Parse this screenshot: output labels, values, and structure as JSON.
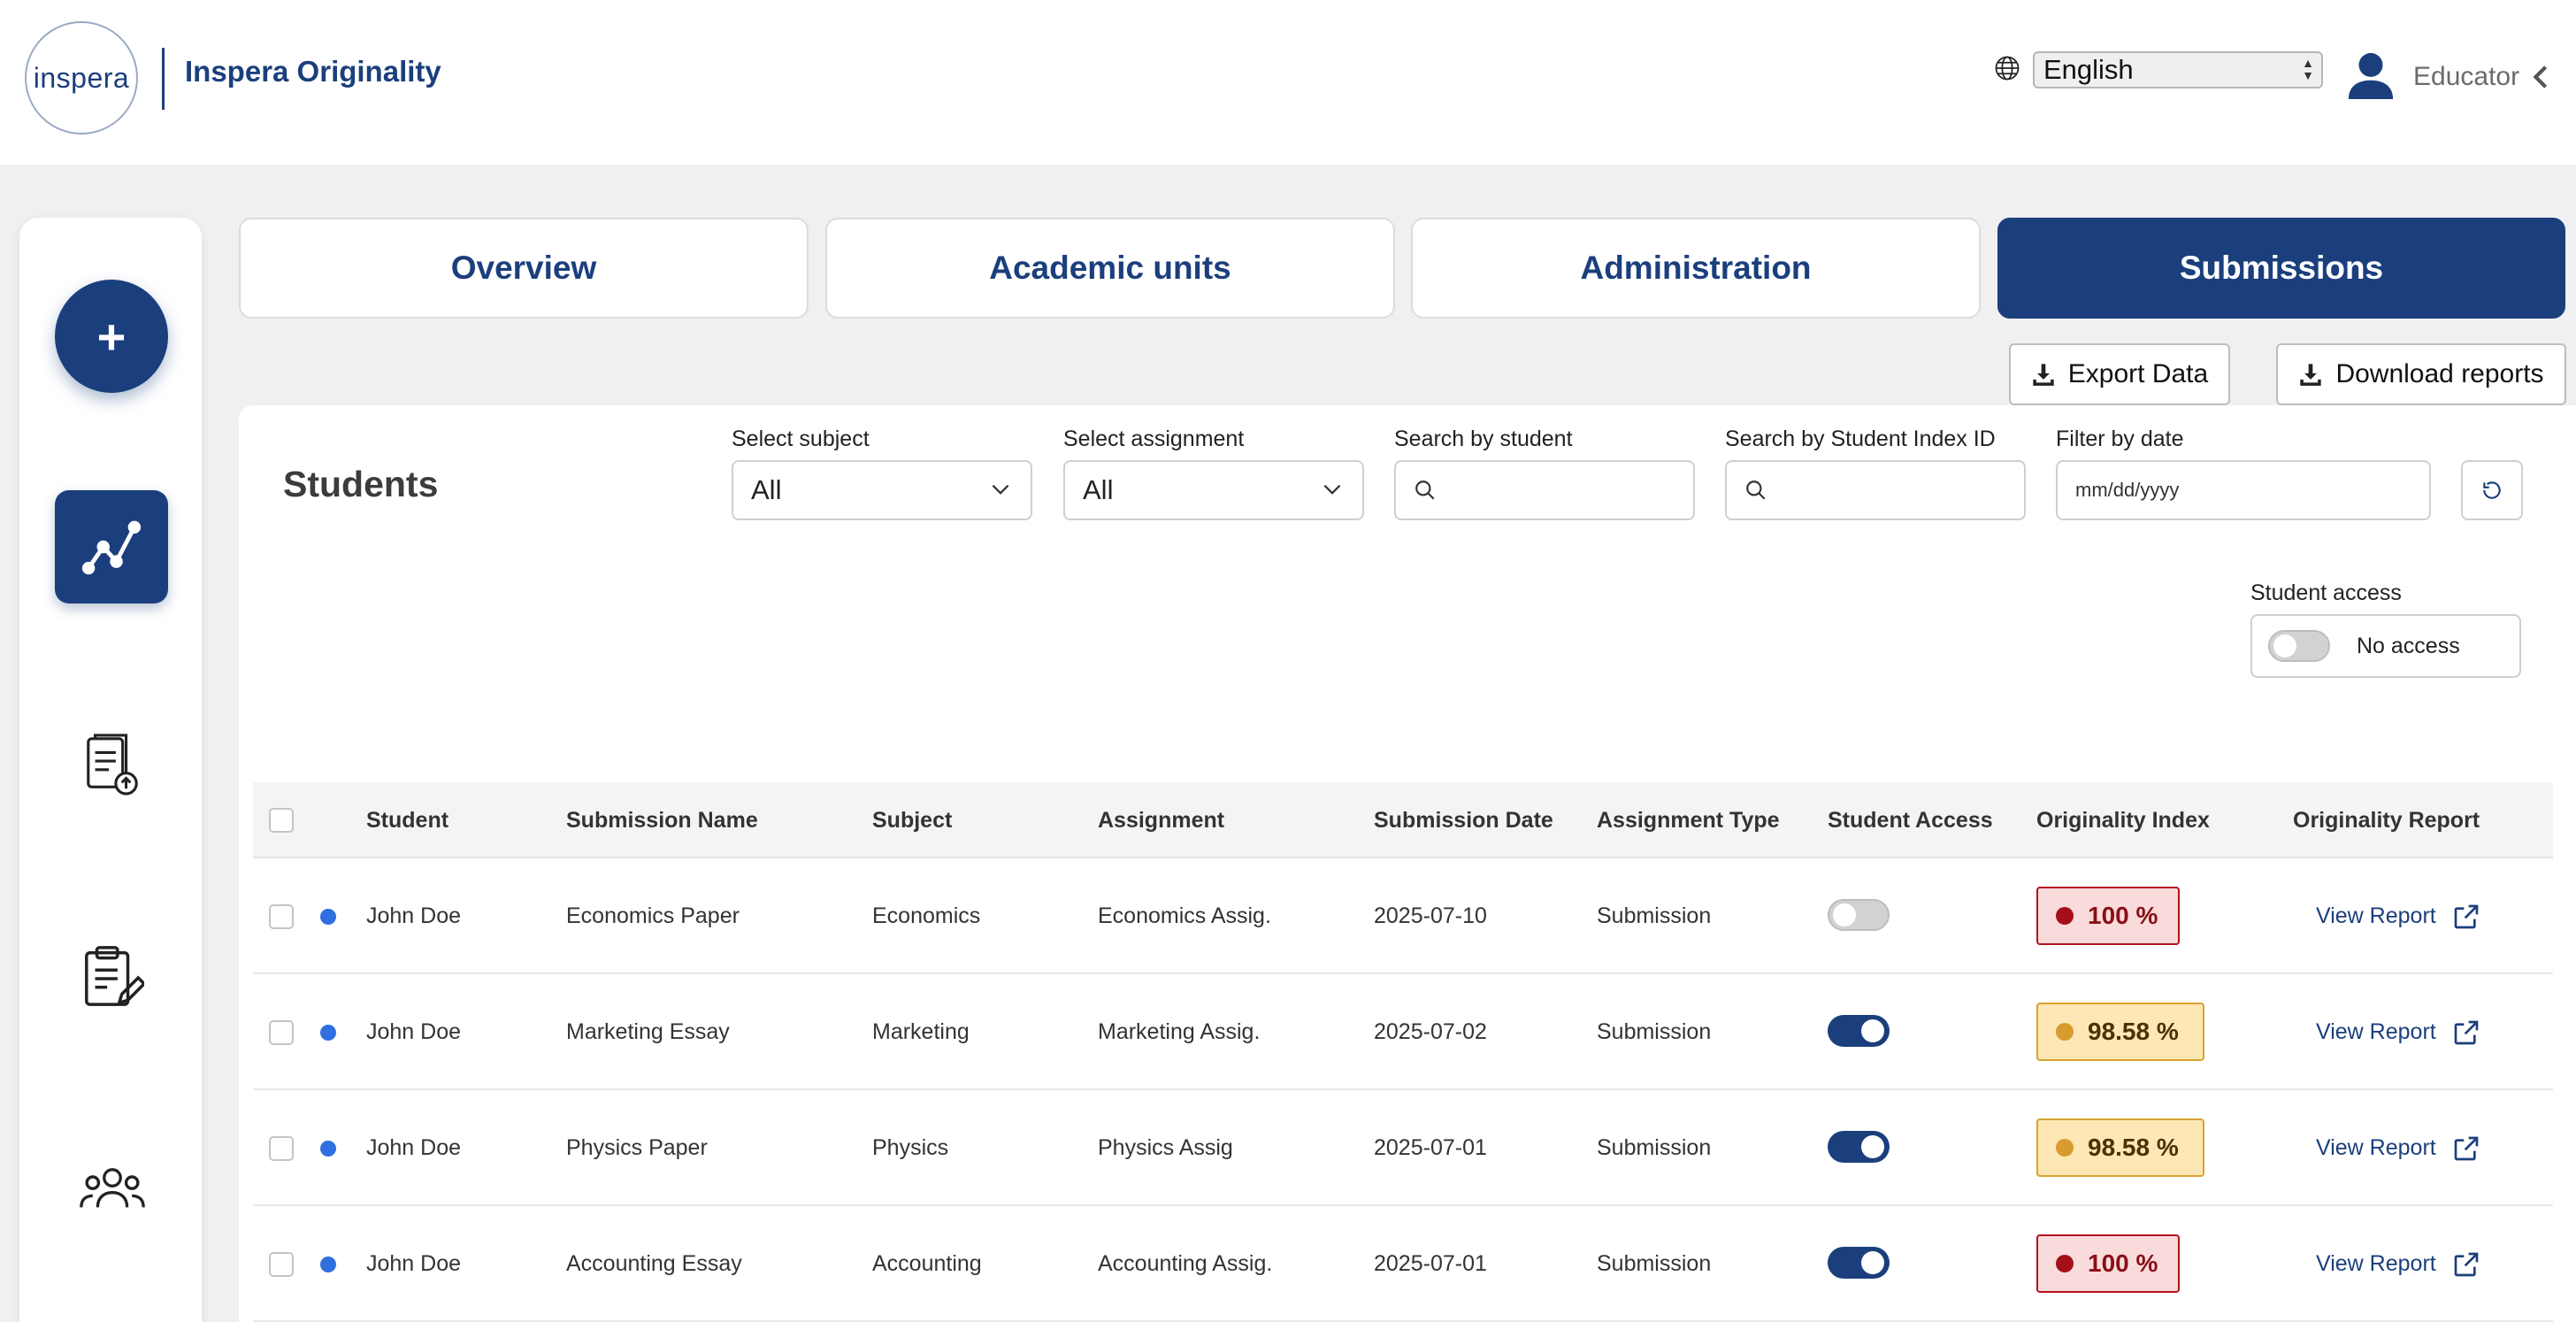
{
  "header": {
    "logo_text": "inspera",
    "app_name": "Inspera Originality",
    "language": "English",
    "role": "Educator"
  },
  "sidebar": {
    "add_label": "+",
    "items": [
      {
        "icon": "analytics-icon",
        "active": true
      },
      {
        "icon": "document-upload-icon",
        "active": false
      },
      {
        "icon": "clipboard-edit-icon",
        "active": false
      },
      {
        "icon": "users-icon",
        "active": false
      }
    ]
  },
  "tabs": [
    {
      "label": "Overview",
      "active": false
    },
    {
      "label": "Academic units",
      "active": false
    },
    {
      "label": "Administration",
      "active": false
    },
    {
      "label": "Submissions",
      "active": true
    }
  ],
  "actions": {
    "export_label": "Export Data",
    "download_label": "Download reports"
  },
  "students": {
    "title": "Students",
    "filters": {
      "subject_label": "Select subject",
      "subject_value": "All",
      "assignment_label": "Select assignment",
      "assignment_value": "All",
      "student_search_label": "Search by student",
      "index_search_label": "Search by Student Index ID",
      "date_label": "Filter by date",
      "date_placeholder": "mm/dd/yyyy"
    },
    "student_access": {
      "label": "Student access",
      "value": "No access"
    }
  },
  "table": {
    "columns": [
      "Student",
      "Submission Name",
      "Subject",
      "Assignment",
      "Submission Date",
      "Assignment Type",
      "Student Access",
      "Originality Index",
      "Originality Report"
    ],
    "rows": [
      {
        "student": "John Doe",
        "submission": "Economics Paper",
        "subject": "Economics",
        "assignment": "Economics Assig.",
        "date": "2025-07-10",
        "type": "Submission",
        "access": false,
        "index": "100 %",
        "level": "high",
        "report": "View Report"
      },
      {
        "student": "John Doe",
        "submission": "Marketing Essay",
        "subject": "Marketing",
        "assignment": "Marketing Assig.",
        "date": "2025-07-02",
        "type": "Submission",
        "access": true,
        "index": "98.58 %",
        "level": "medium",
        "report": "View Report"
      },
      {
        "student": "John Doe",
        "submission": "Physics Paper",
        "subject": "Physics",
        "assignment": "Physics Assig",
        "date": "2025-07-01",
        "type": "Submission",
        "access": true,
        "index": "98.58 %",
        "level": "medium",
        "report": "View Report"
      },
      {
        "student": "John Doe",
        "submission": "Accounting Essay",
        "subject": "Accounting",
        "assignment": "Accounting Assig.",
        "date": "2025-07-01",
        "type": "Submission",
        "access": true,
        "index": "100 %",
        "level": "high",
        "report": "View Report"
      }
    ]
  },
  "colors": {
    "brand": "#1b3f7d",
    "high": "#a40f19",
    "medium": "#d89b2d",
    "unread_dot": "#2f6fe0"
  }
}
